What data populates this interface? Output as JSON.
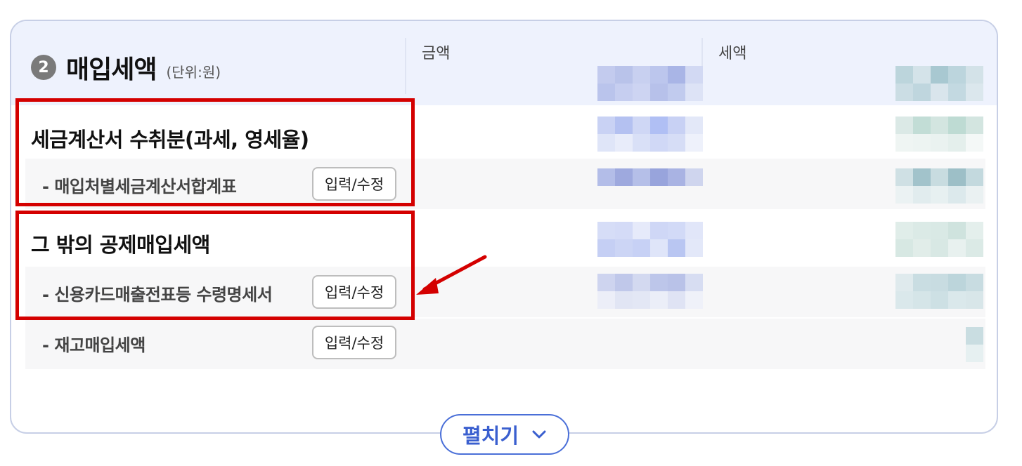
{
  "section": {
    "number": "2",
    "title": "매입세액",
    "unit": "(단위:원)"
  },
  "columns": {
    "amount": "금액",
    "tax": "세액"
  },
  "groups": [
    {
      "label": "세금계산서 수취분(과세, 영세율)",
      "items": [
        {
          "label": "- 매입처별세금계산서합계표",
          "button": "입력/수정"
        }
      ]
    },
    {
      "label": "그 밖의 공제매입세액",
      "items": [
        {
          "label": "- 신용카드매출전표등 수령명세서",
          "button": "입력/수정"
        }
      ]
    }
  ],
  "other_items": [
    {
      "label": "- 재고매입세액",
      "button": "입력/수정"
    }
  ],
  "expand_button": {
    "label": "펼치기",
    "icon": "chevron-down-icon"
  },
  "colors": {
    "highlight": "#d40000",
    "accent": "#3a5fcf",
    "header_band": "#eef2fd"
  }
}
